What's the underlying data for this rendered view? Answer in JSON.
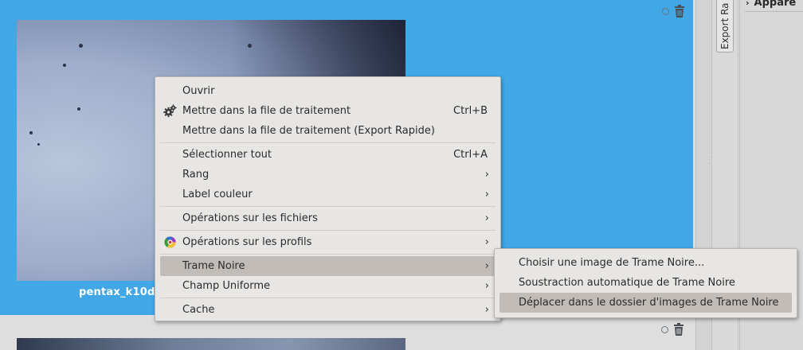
{
  "browser": {
    "thumbnail_label": "pentax_k10d"
  },
  "side": {
    "vertical_tab_label": "Export Ra",
    "panel_header": "Appare"
  },
  "context_menu": {
    "items": [
      {
        "label": "Ouvrir"
      },
      {
        "label": "Mettre dans la file de traitement",
        "shortcut": "Ctrl+B",
        "icon": "gears-icon"
      },
      {
        "label": "Mettre dans la file de traitement (Export Rapide)"
      },
      {
        "label": "Sélectionner tout",
        "shortcut": "Ctrl+A"
      },
      {
        "label": "Rang",
        "submenu": true
      },
      {
        "label": "Label couleur",
        "submenu": true
      },
      {
        "label": "Opérations sur les fichiers",
        "submenu": true
      },
      {
        "label": "Opérations sur les profils",
        "submenu": true,
        "icon": "color-wheel-icon"
      },
      {
        "label": "Trame Noire",
        "submenu": true,
        "highlighted": true
      },
      {
        "label": "Champ Uniforme",
        "submenu": true
      },
      {
        "label": "Cache",
        "submenu": true
      }
    ],
    "submenu_arrow": "›"
  },
  "submenu": {
    "items": [
      {
        "label": "Choisir une image de Trame Noire..."
      },
      {
        "label": "Soustraction automatique de Trame Noire"
      },
      {
        "label": "Déplacer dans le dossier d'images de Trame Noire",
        "highlighted": true
      }
    ]
  },
  "colors": {
    "selection_blue": "#42a7e6",
    "menu_bg": "#e7e6e4",
    "menu_highlight": "#c1bcb7"
  }
}
